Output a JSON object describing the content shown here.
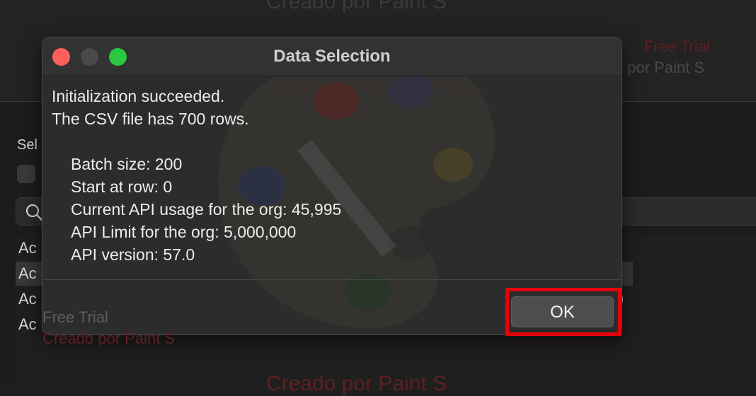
{
  "background": {
    "select_label": "Sel",
    "rows": [
      "Ac",
      "Ac",
      "Ac",
      "Ac"
    ],
    "row_suffix": ")"
  },
  "watermark": {
    "top_title": "Creado por Paint S",
    "trial": "Free Trial",
    "created": "Creado por Paint S",
    "bottom_title": "Creado por Paint S"
  },
  "dialog": {
    "title": "Data Selection",
    "message_lines": [
      "Initialization succeeded.",
      "The CSV file has 700 rows."
    ],
    "details": [
      "Batch size: 200",
      "Start at row: 0",
      "Current API usage for the org: 45,995",
      "API Limit for the org: 5,000,000",
      "API version: 57.0"
    ],
    "ok_label": "OK"
  },
  "colors": {
    "close": "#fe5f57",
    "maximize": "#28c840",
    "highlight": "#e8000d"
  }
}
